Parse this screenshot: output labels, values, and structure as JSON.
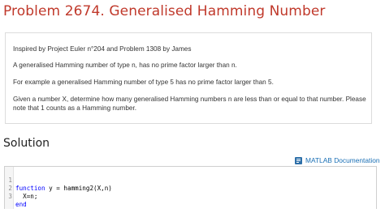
{
  "problem": {
    "title": "Problem 2674. Generalised Hamming Number"
  },
  "description": {
    "lines": [
      "Inspired by Project Euler n°204 and Problem 1308 by James",
      "A generalised Hamming number of type n, has no prime factor larger than n.",
      "For example a generalised Hamming number of type 5 has no prime factor larger than 5.",
      "Given a number X, determine how many generalised Hamming numbers n are less than or equal to that number. Please",
      "note that 1 counts as a Hamming number."
    ]
  },
  "solution": {
    "heading": "Solution",
    "doc_link": "MATLAB Documentation",
    "doc_icon": "matlab-doc-icon",
    "code": [
      {
        "num": "1",
        "keyword": "function",
        "text": " y = hamming2(X,n)"
      },
      {
        "num": "2",
        "keyword": "",
        "text": "  X=n;"
      },
      {
        "num": "3",
        "keyword": "end",
        "text": ""
      }
    ]
  },
  "colors": {
    "title": "#c0392b",
    "link": "#1a6fb5",
    "keyword": "#0000ff"
  }
}
